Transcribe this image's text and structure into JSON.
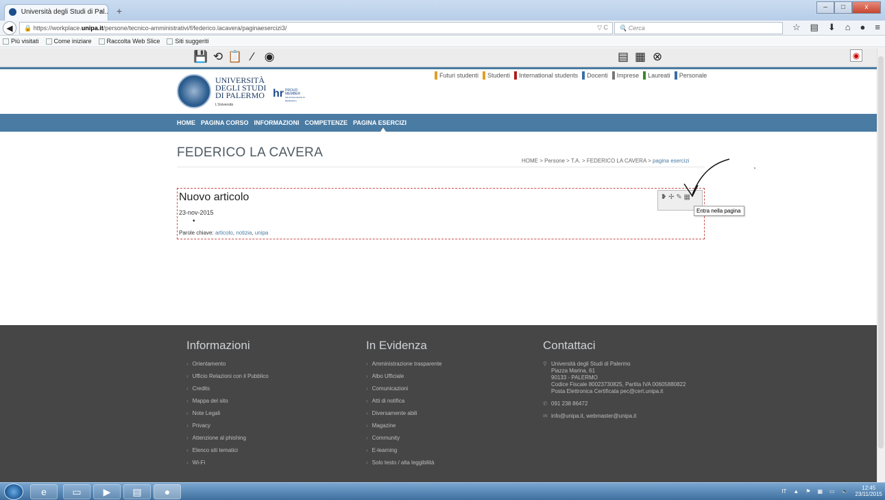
{
  "browser": {
    "tab_title": "Università degli Studi di Pal...",
    "tab_close": "×",
    "new_tab": "+",
    "url_prefix": "https://workplace.",
    "url_domain": "unipa.it",
    "url_path": "/persone/tecnico-amministrativi/f/federico.lacavera/paginaesercizi3/",
    "url_ctrl": "▽ C",
    "search_placeholder": "Cerca",
    "bookmarks": [
      "Più visitati",
      "Come iniziare",
      "Raccolta Web Slice",
      "Siti suggeriti"
    ],
    "window_buttons": [
      "–",
      "□",
      "x"
    ]
  },
  "site": {
    "logo": {
      "line1": "UNIVERSITÀ",
      "line2": "DEGLI STUDI",
      "line3": "DI PALERMO",
      "sub": "L'Università",
      "hr_mark": "hr",
      "hr_text1": "PROUD",
      "hr_text2": "MEMBER",
      "hr_text3": "HR EXCELLENCE IN RESEARCH"
    },
    "top_links": [
      {
        "label": "Futuri studenti",
        "color": "#e0a020"
      },
      {
        "label": "Studenti",
        "color": "#e0a020"
      },
      {
        "label": "International students",
        "color": "#b01c1c"
      },
      {
        "label": "Docenti",
        "color": "#3a6ea5"
      },
      {
        "label": "Imprese",
        "color": "#777777"
      },
      {
        "label": "Laureati",
        "color": "#3a8a2a"
      },
      {
        "label": "Personale",
        "color": "#3a6ea5"
      }
    ],
    "main_nav": [
      "HOME",
      "PAGINA CORSO",
      "INFORMAZIONI",
      "COMPETENZE",
      "PAGINA ESERCIZI"
    ],
    "page_title": "FEDERICO LA CAVERA",
    "breadcrumb": {
      "items": [
        "HOME",
        "Persone",
        "T.A.",
        "FEDERICO LA CAVERA"
      ],
      "separator": ">",
      "current": "pagina esercizi"
    },
    "article": {
      "title": "Nuovo articolo",
      "date": "23-nov-2015",
      "bullet": "•",
      "tags_label": "Parole chiave:",
      "tags": [
        "articolo",
        "notizia",
        "unipa"
      ],
      "tooltip": "Entra nella pagina"
    }
  },
  "footer": {
    "informazioni": {
      "title": "Informazioni",
      "items": [
        "Orientamento",
        "Ufficio Relazioni con il Pubblico",
        "Credits",
        "Mappa del sito",
        "Note Legali",
        "Privacy",
        "Attenzione al phishing",
        "Elenco siti tematici",
        "Wi-Fi"
      ]
    },
    "evidenza": {
      "title": "In Evidenza",
      "items": [
        "Amministrazione trasparente",
        "Albo Ufficiale",
        "Comunicazioni",
        "Atti di notifica",
        "Diversamente abili",
        "Magazine",
        "Community",
        "E-learning",
        "Solo testo / alta leggibilità"
      ]
    },
    "contattaci": {
      "title": "Contattaci",
      "address": [
        "Università degli Studi di Palermo",
        "Piazza Marina, 61",
        "90133 - PALERMO",
        "Codice Fiscale 80023730825, Partita IVA 00605880822",
        "Posta Elettronica Certificata pec@cert.unipa.it"
      ],
      "phone": "091 238 86472",
      "email": "info@unipa.it, webmaster@unipa.it"
    }
  },
  "taskbar": {
    "lang": "IT",
    "time": "12:45",
    "date": "23/11/2015"
  }
}
